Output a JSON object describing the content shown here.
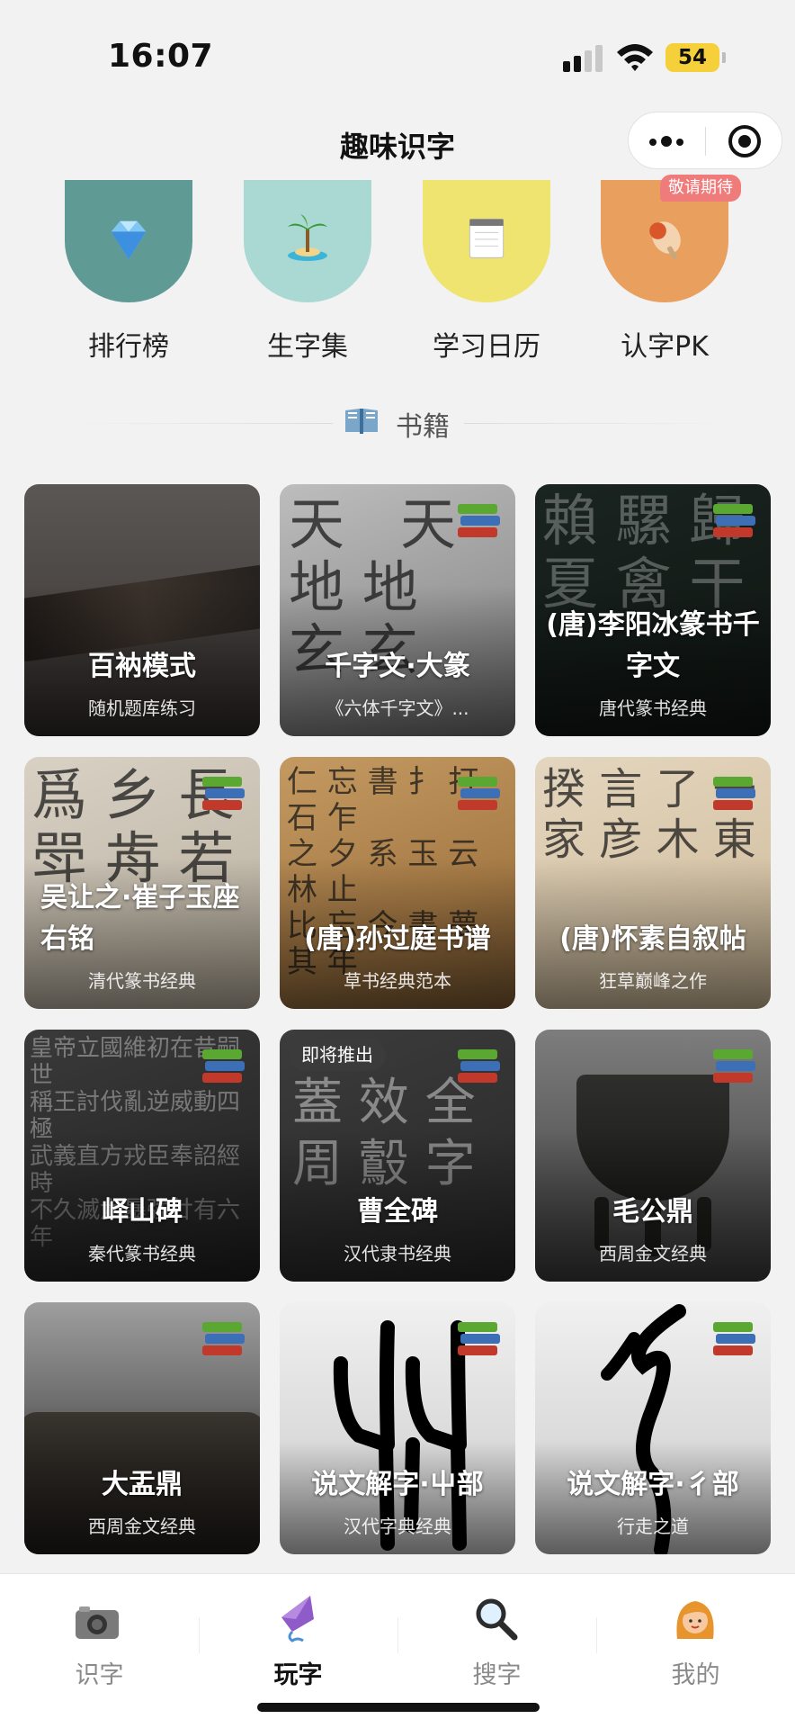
{
  "status_bar": {
    "time": "16:07",
    "battery": "54"
  },
  "nav": {
    "title": "趣味识字"
  },
  "features": [
    {
      "label": "排行榜",
      "icon": "diamond-icon",
      "color": "#5f9a95"
    },
    {
      "label": "生字集",
      "icon": "palm-island-icon",
      "color": "#a9d9d2"
    },
    {
      "label": "学习日历",
      "icon": "notepad-icon",
      "color": "#efe470"
    },
    {
      "label": "认字PK",
      "icon": "ping-pong-icon",
      "color": "#e9a05e",
      "badge": "敬请期待"
    }
  ],
  "section": {
    "title": "书籍",
    "icon": "open-book-icon"
  },
  "books": [
    {
      "title": "百衲模式",
      "subtitle": "随机题库练习",
      "icon": "none"
    },
    {
      "title": "千字文·大篆",
      "subtitle": "《六体千字文》...",
      "icon": "books-icon"
    },
    {
      "title": "(唐)李阳冰篆书千字文",
      "subtitle": "唐代篆书经典",
      "icon": "books-icon"
    },
    {
      "title": "吴让之·崔子玉座右铭",
      "subtitle": "清代篆书经典",
      "icon": "books-icon"
    },
    {
      "title": "(唐)孙过庭书谱",
      "subtitle": "草书经典范本",
      "icon": "books-icon"
    },
    {
      "title": "(唐)怀素自叙帖",
      "subtitle": "狂草巅峰之作",
      "icon": "books-icon"
    },
    {
      "title": "峄山碑",
      "subtitle": "秦代篆书经典",
      "icon": "books-icon"
    },
    {
      "title": "曹全碑",
      "subtitle": "汉代隶书经典",
      "icon": "books-icon",
      "badge": "即将推出"
    },
    {
      "title": "毛公鼎",
      "subtitle": "西周金文经典",
      "icon": "books-icon"
    },
    {
      "title": "大盂鼎",
      "subtitle": "西周金文经典",
      "icon": "books-icon"
    },
    {
      "title": "说文解字·屮部",
      "subtitle": "汉代字典经典",
      "icon": "books-icon"
    },
    {
      "title": "说文解字·彳部",
      "subtitle": "行走之道",
      "icon": "books-icon"
    }
  ],
  "tabs": [
    {
      "label": "识字",
      "icon": "camera-icon",
      "active": false
    },
    {
      "label": "玩字",
      "icon": "kite-icon",
      "active": true
    },
    {
      "label": "搜字",
      "icon": "magnifier-icon",
      "active": false
    },
    {
      "label": "我的",
      "icon": "girl-avatar-icon",
      "active": false
    }
  ]
}
